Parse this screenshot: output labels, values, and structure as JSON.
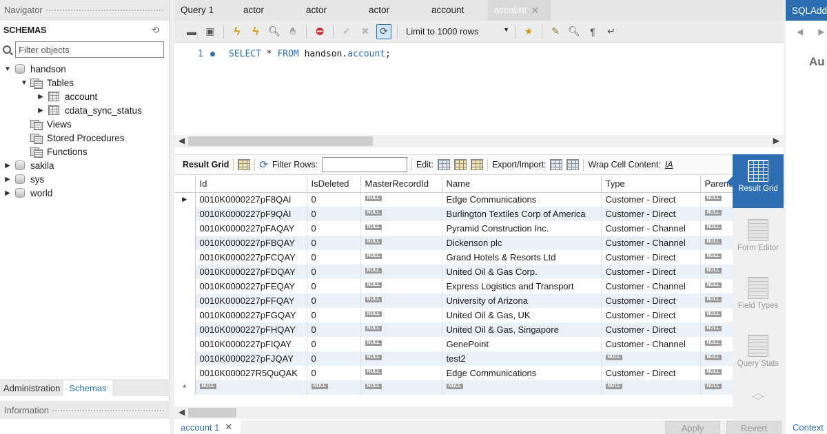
{
  "navigator": {
    "title": "Navigator",
    "schemas_label": "SCHEMAS",
    "filter_placeholder": "Filter objects",
    "tree": {
      "handson": "handson",
      "tables": "Tables",
      "account": "account",
      "cdata": "cdata_sync_status",
      "views": "Views",
      "procs": "Stored Procedures",
      "funcs": "Functions",
      "sakila": "sakila",
      "sys": "sys",
      "world": "world"
    },
    "tabs": [
      "Administration",
      "Schemas"
    ],
    "info_title": "Information"
  },
  "query_tabs": [
    "Query 1",
    "actor",
    "actor",
    "actor",
    "account",
    "account"
  ],
  "toolbar": {
    "limit_label": "Limit to 1000 rows"
  },
  "editor": {
    "line_no": "1",
    "kw1": "SELECT",
    "mid1": " * ",
    "kw2": "FROM",
    "mid2": " handson.",
    "kw3": "account",
    "tail": ";"
  },
  "result_toolbar": {
    "result_grid": "Result Grid",
    "filter_rows": "Filter Rows:",
    "edit": "Edit:",
    "export": "Export/Import:",
    "wrap": "Wrap Cell Content:"
  },
  "grid": {
    "columns": [
      "Id",
      "IsDeleted",
      "MasterRecordId",
      "Name",
      "Type",
      "ParentI"
    ],
    "null_label": "NULL",
    "rows": [
      {
        "id": "0010K0000227pF8QAI",
        "del": "0",
        "name": "Edge Communications",
        "type": "Customer - Direct"
      },
      {
        "id": "0010K0000227pF9QAI",
        "del": "0",
        "name": "Burlington Textiles Corp of America",
        "type": "Customer - Direct"
      },
      {
        "id": "0010K0000227pFAQAY",
        "del": "0",
        "name": "Pyramid Construction Inc.",
        "type": "Customer - Channel"
      },
      {
        "id": "0010K0000227pFBQAY",
        "del": "0",
        "name": "Dickenson plc",
        "type": "Customer - Channel"
      },
      {
        "id": "0010K0000227pFCQAY",
        "del": "0",
        "name": "Grand Hotels & Resorts Ltd",
        "type": "Customer - Direct"
      },
      {
        "id": "0010K0000227pFDQAY",
        "del": "0",
        "name": "United Oil & Gas Corp.",
        "type": "Customer - Direct"
      },
      {
        "id": "0010K0000227pFEQAY",
        "del": "0",
        "name": "Express Logistics and Transport",
        "type": "Customer - Channel"
      },
      {
        "id": "0010K0000227pFFQAY",
        "del": "0",
        "name": "University of Arizona",
        "type": "Customer - Direct"
      },
      {
        "id": "0010K0000227pFGQAY",
        "del": "0",
        "name": "United Oil & Gas, UK",
        "type": "Customer - Direct"
      },
      {
        "id": "0010K0000227pFHQAY",
        "del": "0",
        "name": "United Oil & Gas, Singapore",
        "type": "Customer - Direct"
      },
      {
        "id": "0010K0000227pFIQAY",
        "del": "0",
        "name": "GenePoint",
        "type": "Customer - Channel"
      },
      {
        "id": "0010K0000227pFJQAY",
        "del": "0",
        "name": "test2",
        "type": ""
      },
      {
        "id": "0010K000027R5QuQAK",
        "del": "0",
        "name": "Edge Communications",
        "type": "Customer - Direct"
      }
    ]
  },
  "side_modes": [
    "Result Grid",
    "Form Editor",
    "Field Types",
    "Query Stats"
  ],
  "bottom": {
    "result_tab": "account 1",
    "apply": "Apply",
    "revert": "Revert"
  },
  "right_panel": {
    "title": "SQLAdditions",
    "heading": "Au",
    "context": "Context"
  }
}
